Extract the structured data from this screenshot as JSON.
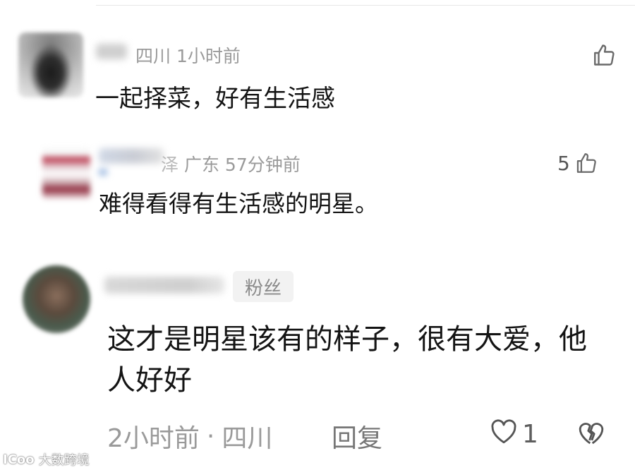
{
  "comments": [
    {
      "meta": "四川 1小时前",
      "text": "一起择菜，好有生活感",
      "like_icon": "thumbs-up-icon"
    },
    {
      "meta_prefix": "泽",
      "meta": "广东 57分钟前",
      "text": "难得看得有生活感的明星。",
      "like_count": "5",
      "like_icon": "thumbs-up-icon"
    },
    {
      "badge": "粉丝",
      "text": "这才是明星该有的样子，很有大爱，他人好好",
      "footer": {
        "time": "2小时前",
        "separator": "·",
        "location": "四川",
        "reply": "回复",
        "like_count": "1",
        "like_icon": "heart-icon",
        "dislike_icon": "broken-heart-icon"
      }
    }
  ],
  "watermark": {
    "logo": "ICoo",
    "text": "大数跨境"
  },
  "colors": {
    "meta": "#9a9a9a",
    "text": "#141414",
    "badge_bg": "#f2f2f2"
  }
}
